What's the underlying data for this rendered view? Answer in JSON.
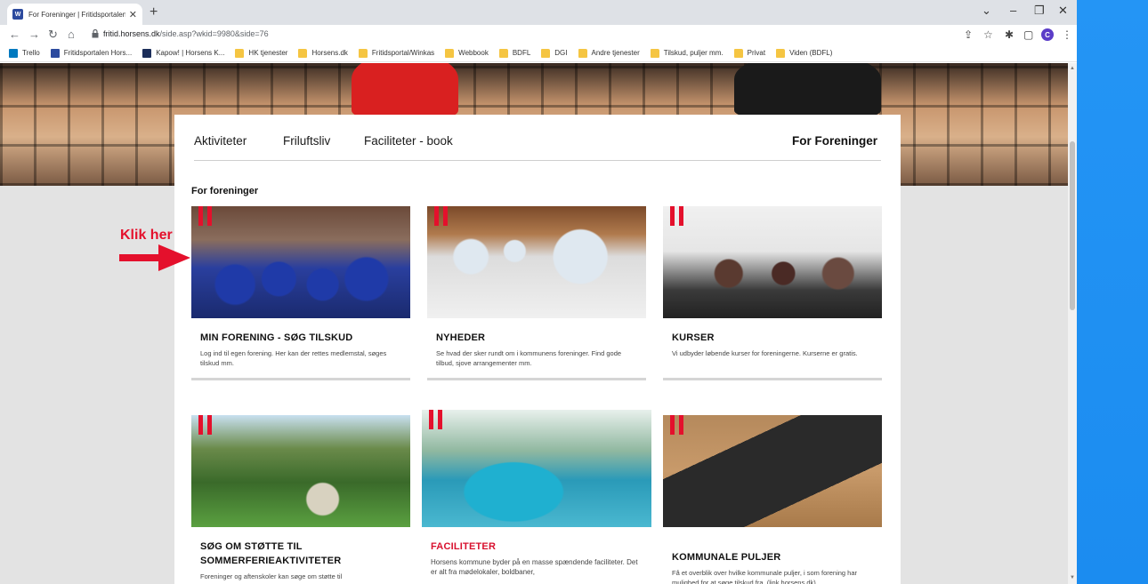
{
  "browser": {
    "tab": {
      "favicon_letter": "W",
      "title": "For Foreninger | Fritidsportalen H",
      "close": "✕"
    },
    "new_tab": "+",
    "window_controls": {
      "chevron": "⌄",
      "minimize": "–",
      "restore": "❐",
      "close": "✕"
    },
    "url": {
      "domain": "fritid.horsens.dk",
      "path": "/side.asp?wkid=9980&side=76"
    },
    "profile_letter": "C",
    "bookmarks": [
      {
        "label": "Trello",
        "icon": "trello-icon"
      },
      {
        "label": "Fritidsportalen Hors...",
        "icon": "fritidsportalen-icon"
      },
      {
        "label": "Kapow! | Horsens K...",
        "icon": "kapow-icon"
      },
      {
        "label": "HK tjenester",
        "icon": "folder-icon"
      },
      {
        "label": "Horsens.dk",
        "icon": "folder-icon"
      },
      {
        "label": "Fritidsportal/Winkas",
        "icon": "folder-icon"
      },
      {
        "label": "Webbook",
        "icon": "folder-icon"
      },
      {
        "label": "BDFL",
        "icon": "folder-icon"
      },
      {
        "label": "DGI",
        "icon": "folder-icon"
      },
      {
        "label": "Andre tjenester",
        "icon": "folder-icon"
      },
      {
        "label": "Tilskud, puljer mm.",
        "icon": "folder-icon"
      },
      {
        "label": "Privat",
        "icon": "folder-icon"
      },
      {
        "label": "Viden (BDFL)",
        "icon": "folder-icon"
      }
    ]
  },
  "page": {
    "nav": {
      "items": [
        "Aktiviteter",
        "Friluftsliv",
        "Faciliteter - book"
      ],
      "right": "For Foreninger"
    },
    "section_title": "For foreninger",
    "cards": [
      {
        "title": "MIN FORENING - SØG TILSKUD",
        "desc": "Log ind til egen forening. Her kan der rettes medlemstal, søges tilskud mm."
      },
      {
        "title": "NYHEDER",
        "desc": "Se hvad der sker rundt om i kommunens foreninger. Find gode tilbud, sjove arrangementer mm."
      },
      {
        "title": "KURSER",
        "desc": "Vi udbyder løbende kurser for foreningerne. Kurserne er gratis."
      },
      {
        "title": "SØG OM STØTTE TIL SOMMERFERIEAKTIVITETER",
        "desc": "Foreninger og aftenskoler kan søge om støtte til"
      },
      {
        "title": "FACILITETER",
        "desc": "Horsens kommune byder på en masse spændende faciliteter. Det er alt fra mødelokaler, boldbaner,"
      },
      {
        "title": "KOMMUNALE PULJER",
        "desc": "Få et overblik over hvilke kommunale puljer, i som forening har mulighed for at søge tilskud fra. (link horsens.dk)"
      }
    ],
    "annotation": "Klik her"
  },
  "colors": {
    "accent_red": "#e4102c",
    "page_bg": "#e3e3e3",
    "desktop_blue": "#1e90ff"
  }
}
